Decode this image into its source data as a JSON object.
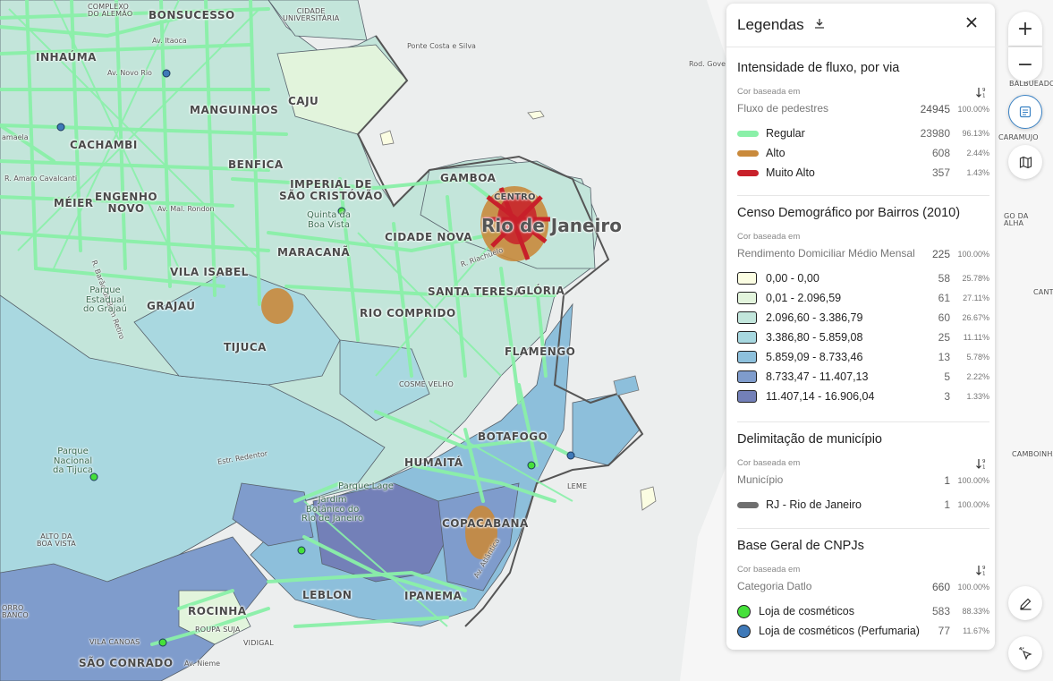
{
  "map": {
    "labels": {
      "complexo_alemao": "COMPLEXO\nDO ALEMÃO",
      "bonsucesso": "BONSUCESSO",
      "cidade_universitaria": "CIDADE\nUNIVERSITÁRIA",
      "inhauma": "INHAÚMA",
      "av_itaoca": "Av. Itaoca",
      "av_novo_rio": "Av. Novo Rio",
      "ponte_costa_silva": "Ponte Costa e Silva",
      "rod_gov": "Rod. Gove",
      "manguinhos": "MANGUINHOS",
      "caju": "CAJU",
      "cachambi": "CACHAMBI",
      "benfica": "BENFICA",
      "amaro_cavalcanti": "R. Amaro Cavalcanti",
      "meier": "MÉIER",
      "engenho_novo": "ENGENHO\nNOVO",
      "av_mal_rondon": "Av. Mal. Rondon",
      "imperial": "IMPERIAL DE\nSÃO CRISTÓVÃO",
      "quinta": "Quinta da\nBoa Vista",
      "gamboa": "GAMBOA",
      "centro": "CENTRO",
      "rio_de_janeiro": "Rio de Janeiro",
      "cidade_nova": "CIDADE NOVA",
      "r_riachuelo": "R. Riachuelo",
      "barao_bom_retiro": "R. Barão do Bom Retiro",
      "vila_isabel": "VILA ISABEL",
      "maracana": "MARACANÃ",
      "santa_teresa": "SANTA TERESA",
      "gloria": "GLÓRIA",
      "parque_grajau": "Parque\nEstadual\ndo Grajaú",
      "grajau": "GRAJAÚ",
      "rio_comprido": "RIO COMPRIDO",
      "tijuca": "TIJUCA",
      "flamengo": "FLAMENGO",
      "cosme_velho": "COSME VELHO",
      "parque_tijuca": "Parque\nNacional\nda Tijuca",
      "estr_redentor": "Estr. Redentor",
      "botafogo": "BOTAFOGO",
      "humaita": "HUMAITÁ",
      "leme": "LEME",
      "parque_lage": "Parque Lage",
      "jardim_botanico": "Jardim\nBotânico do\nRio de Janeiro",
      "alto_boa_vista": "ALTO DA\nBOA VISTA",
      "copacabana": "COPACABANA",
      "av_atlantica": "Av. Atlântica",
      "orro_banco": "ORRO\nBANCO",
      "rocinha": "ROCINHA",
      "leblon": "LEBLON",
      "ipanema": "IPANEMA",
      "roupa_suja": "ROUPA SUJA",
      "vila_canoas": "VILA CANOAS",
      "vidigal": "VIDIGAL",
      "sao_conrado": "SÃO CONRADO",
      "av_niemeyer": "Av. Nieme",
      "balbueador": "BALBUEADOR",
      "caramujo": "CARAMUJO",
      "go_da_alha": "GO DA\nALHA",
      "cant": "CANT",
      "camboinha": "CAMBOINHA",
      "amaela": "amaela"
    }
  },
  "legend": {
    "title": "Legendas",
    "cor_label": "Cor baseada em",
    "sections": [
      {
        "title": "Intensidade de fluxo, por via",
        "basis": "Fluxo de pedestres",
        "total": "24945",
        "total_pct": "100.00%",
        "kind": "line",
        "items": [
          {
            "label": "Regular",
            "count": "23980",
            "pct": "96.13%",
            "color": "#8af0a8"
          },
          {
            "label": "Alto",
            "count": "608",
            "pct": "2.44%",
            "color": "#c98a3c"
          },
          {
            "label": "Muito Alto",
            "count": "357",
            "pct": "1.43%",
            "color": "#c8202a"
          }
        ]
      },
      {
        "title": "Censo Demográfico por Bairros (2010)",
        "basis": "Rendimento Domiciliar Médio Mensal",
        "total": "225",
        "total_pct": "100.00%",
        "kind": "box",
        "items": [
          {
            "label": "0,00 - 0,00",
            "count": "58",
            "pct": "25.78%",
            "color": "#fbfde2"
          },
          {
            "label": "0,01 - 2.096,59",
            "count": "61",
            "pct": "27.11%",
            "color": "#e2f4dc"
          },
          {
            "label": "2.096,60 - 3.386,79",
            "count": "60",
            "pct": "26.67%",
            "color": "#c2e6dc"
          },
          {
            "label": "3.386,80 - 5.859,08",
            "count": "25",
            "pct": "11.11%",
            "color": "#a7d8e0"
          },
          {
            "label": "5.859,09 - 8.733,46",
            "count": "13",
            "pct": "5.78%",
            "color": "#8dc0dc"
          },
          {
            "label": "8.733,47 - 11.407,13",
            "count": "5",
            "pct": "2.22%",
            "color": "#7f9ccc"
          },
          {
            "label": "11.407,14 - 16.906,04",
            "count": "3",
            "pct": "1.33%",
            "color": "#7380b8"
          }
        ]
      },
      {
        "title": "Delimitação de município",
        "basis": "Município",
        "total": "1",
        "total_pct": "100.00%",
        "kind": "line",
        "items": [
          {
            "label": "RJ - Rio de Janeiro",
            "count": "1",
            "pct": "100.00%",
            "color": "#6f6f6f"
          }
        ]
      },
      {
        "title": "Base Geral de CNPJs",
        "basis": "Categoria Datlo",
        "total": "660",
        "total_pct": "100.00%",
        "kind": "dot",
        "items": [
          {
            "label": "Loja de cosméticos",
            "count": "583",
            "pct": "88.33%",
            "color": "#45e03a"
          },
          {
            "label": "Loja de cosméticos (Perfumaria)",
            "count": "77",
            "pct": "11.67%",
            "color": "#3f79b8"
          }
        ]
      }
    ]
  },
  "controls": {
    "zoom_in": "+",
    "zoom_out": "−"
  }
}
